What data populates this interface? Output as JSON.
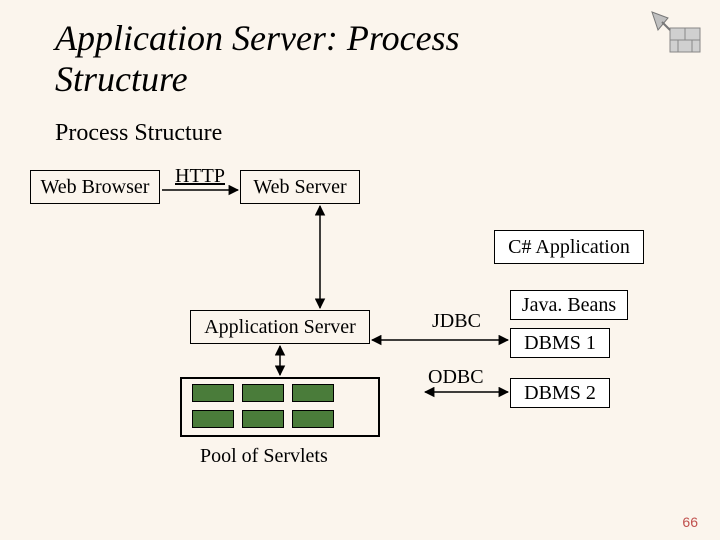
{
  "title_line1": "Application Server: Process",
  "title_line2": "Structure",
  "subtitle": "Process Structure",
  "page_number": "66",
  "nodes": {
    "web_browser": "Web Browser",
    "web_server": "Web Server",
    "app_server": "Application Server",
    "csharp_app": "C# Application",
    "javabeans": "Java. Beans",
    "dbms1": "DBMS 1",
    "dbms2": "DBMS 2",
    "servlet_pool_label": "Pool of Servlets"
  },
  "edges": {
    "http": "HTTP",
    "jdbc": "JDBC",
    "odbc": "ODBC"
  },
  "icon": "trowel-brick-icon"
}
